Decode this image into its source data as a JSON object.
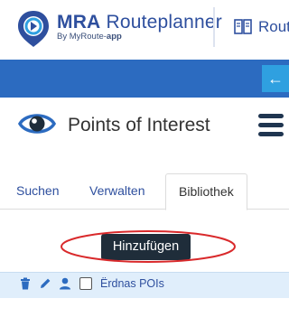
{
  "brand": {
    "name_bold": "MRA",
    "name_rest": " Routeplanner",
    "by_prefix": "By MyRoute-",
    "by_bold": "app"
  },
  "nav": {
    "route_label": "Rout",
    "back_icon": "arrow-left"
  },
  "panel": {
    "title": "Points of Interest"
  },
  "tabs": [
    {
      "label": "Suchen",
      "active": false
    },
    {
      "label": "Verwalten",
      "active": false
    },
    {
      "label": "Bibliothek",
      "active": true
    }
  ],
  "actions": {
    "add_label": "Hinzufügen"
  },
  "library": {
    "items": [
      {
        "label": "Ërdnas POIs",
        "checked": false
      }
    ]
  },
  "colors": {
    "brand_blue": "#2e4f9e",
    "bar_blue": "#2c6bc0",
    "accent_cyan": "#2fa0e0",
    "dark_button": "#1f2d3a",
    "row_highlight": "#e0eefb",
    "annotation_red": "#d9292b"
  }
}
